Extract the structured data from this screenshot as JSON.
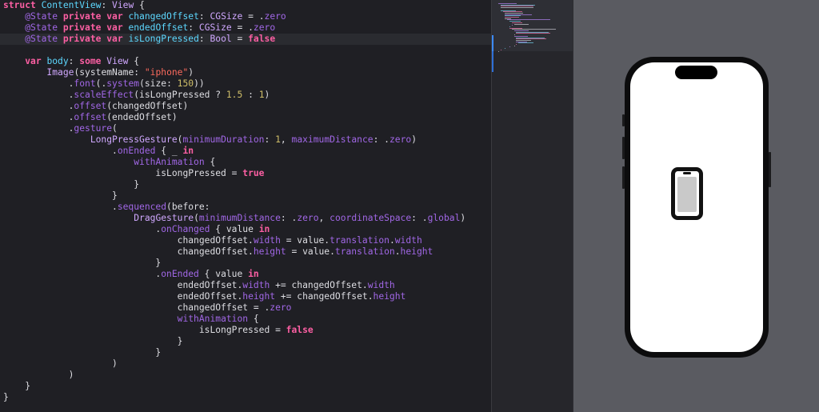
{
  "editor": {
    "lines": [
      "struct ContentView: View {",
      "    @State private var changedOffset: CGSize = .zero",
      "    @State private var endedOffset: CGSize = .zero",
      "    @State private var isLongPressed: Bool = false",
      "",
      "    var body: some View {",
      "        Image(systemName: \"iphone\")",
      "            .font(.system(size: 150))",
      "            .scaleEffect(isLongPressed ? 1.5 : 1)",
      "            .offset(changedOffset)",
      "            .offset(endedOffset)",
      "            .gesture(",
      "                LongPressGesture(minimumDuration: 1, maximumDistance: .zero)",
      "                    .onEnded { _ in",
      "                        withAnimation {",
      "                            isLongPressed = true",
      "                        }",
      "                    }",
      "                    .sequenced(before:",
      "                        DragGesture(minimumDistance: .zero, coordinateSpace: .global)",
      "                            .onChanged { value in",
      "                                changedOffset.width = value.translation.width",
      "                                changedOffset.height = value.translation.height",
      "                            }",
      "                            .onEnded { value in",
      "                                endedOffset.width += changedOffset.width",
      "                                endedOffset.height += changedOffset.height",
      "                                changedOffset = .zero",
      "                                withAnimation {",
      "                                    isLongPressed = false",
      "                                }",
      "                            }",
      "                    )",
      "            )",
      "    }",
      "}"
    ]
  },
  "preview": {
    "device": "iPhone",
    "content_icon": "iphone-icon",
    "colors": {
      "phone_frame": "#0c0c0d",
      "screen": "#ffffff",
      "canvas": "#5a5b61",
      "glyph": "#111111"
    }
  }
}
